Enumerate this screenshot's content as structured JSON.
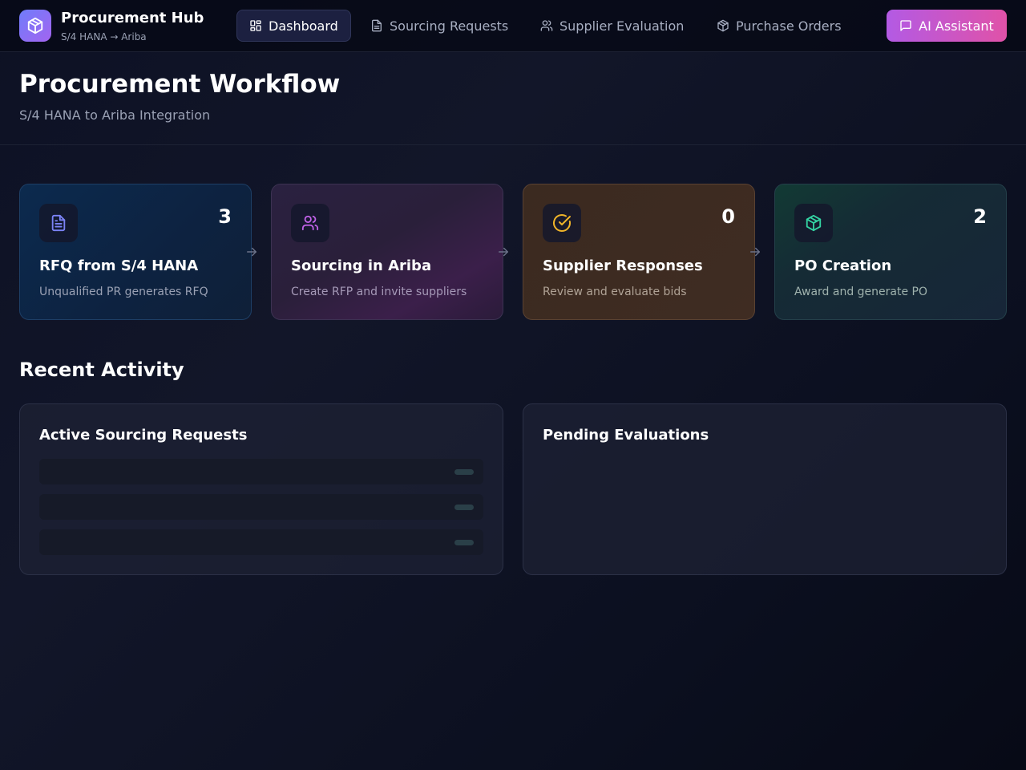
{
  "brand": {
    "name": "Procurement Hub",
    "subtitle": "S/4 HANA → Ariba",
    "logo_icon": "package-icon"
  },
  "nav": {
    "items": [
      {
        "label": "Dashboard",
        "icon": "grid-icon",
        "active": true
      },
      {
        "label": "Sourcing Requests",
        "icon": "document-icon",
        "active": false
      },
      {
        "label": "Supplier Evaluation",
        "icon": "users-icon",
        "active": false
      },
      {
        "label": "Purchase Orders",
        "icon": "package-icon",
        "active": false
      }
    ],
    "ai_button": {
      "label": "AI Assistant",
      "icon": "chat-icon"
    }
  },
  "header": {
    "title": "Procurement Workflow",
    "subtitle": "S/4 HANA to Ariba Integration"
  },
  "workflow": [
    {
      "title": "RFQ from S/4 HANA",
      "description": "Unqualified PR generates RFQ",
      "count": "3",
      "icon": "document-icon",
      "accent": "#7b83f6"
    },
    {
      "title": "Sourcing in Ariba",
      "description": "Create RFP and invite suppliers",
      "count": "",
      "icon": "users-icon",
      "accent": "#c162e8"
    },
    {
      "title": "Supplier Responses",
      "description": "Review and evaluate bids",
      "count": "0",
      "icon": "check-circle-icon",
      "accent": "#f0b429"
    },
    {
      "title": "PO Creation",
      "description": "Award and generate PO",
      "count": "2",
      "icon": "package-icon",
      "accent": "#34d3a2"
    }
  ],
  "activity": {
    "title": "Recent Activity",
    "panels": [
      {
        "title": "Active Sourcing Requests",
        "loading_rows": 3
      },
      {
        "title": "Pending Evaluations",
        "loading_rows": 0
      }
    ]
  },
  "colors": {
    "accent_gradient_start": "#b35ae4",
    "accent_gradient_end": "#e052a8",
    "active_nav_bg": "#1c2040"
  }
}
